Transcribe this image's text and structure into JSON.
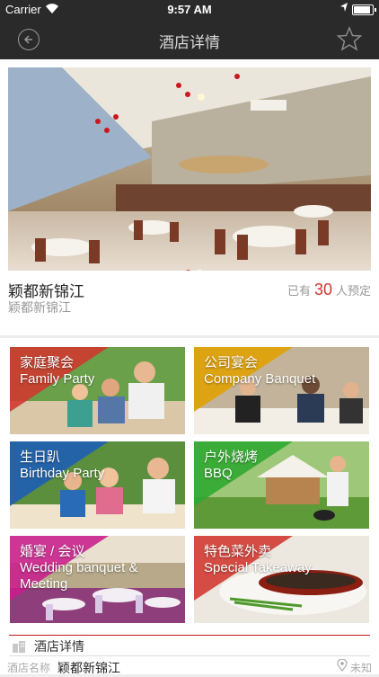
{
  "status_bar": {
    "carrier": "Carrier",
    "time": "9:57 AM"
  },
  "nav": {
    "title": "酒店详情"
  },
  "hotel": {
    "name": "颖都新锦江",
    "subtitle": "颖都新锦江",
    "booked_prefix": "已有",
    "booked_count": "30",
    "booked_suffix": "人预定",
    "carousel_active_index": 0,
    "carousel_count": 2
  },
  "categories": [
    {
      "label_cn": "家庭聚会",
      "label_en": "Family Party",
      "accent": "#d0372d"
    },
    {
      "label_cn": "公司宴会",
      "label_en": "Company Banquet",
      "accent": "#e0a000"
    },
    {
      "label_cn": "生日趴",
      "label_en": "Birthday Party",
      "accent": "#1e5db8"
    },
    {
      "label_cn": "户外烧烤",
      "label_en": "BBQ",
      "accent": "#2ea82e"
    },
    {
      "label_cn": "婚宴 / 会议",
      "label_en": "Wedding banquet & Meeting",
      "accent": "#c81e8c"
    },
    {
      "label_cn": "特色菜外卖",
      "label_en": "Special Takeaway",
      "accent": "#d0372d"
    }
  ],
  "detail": {
    "section_title": "酒店详情",
    "name_key": "酒店名称",
    "name_value": "颖都新锦江",
    "location": "未知"
  },
  "colors": {
    "accent_red": "#d0372d",
    "nav_bg": "#2a2a2a"
  }
}
